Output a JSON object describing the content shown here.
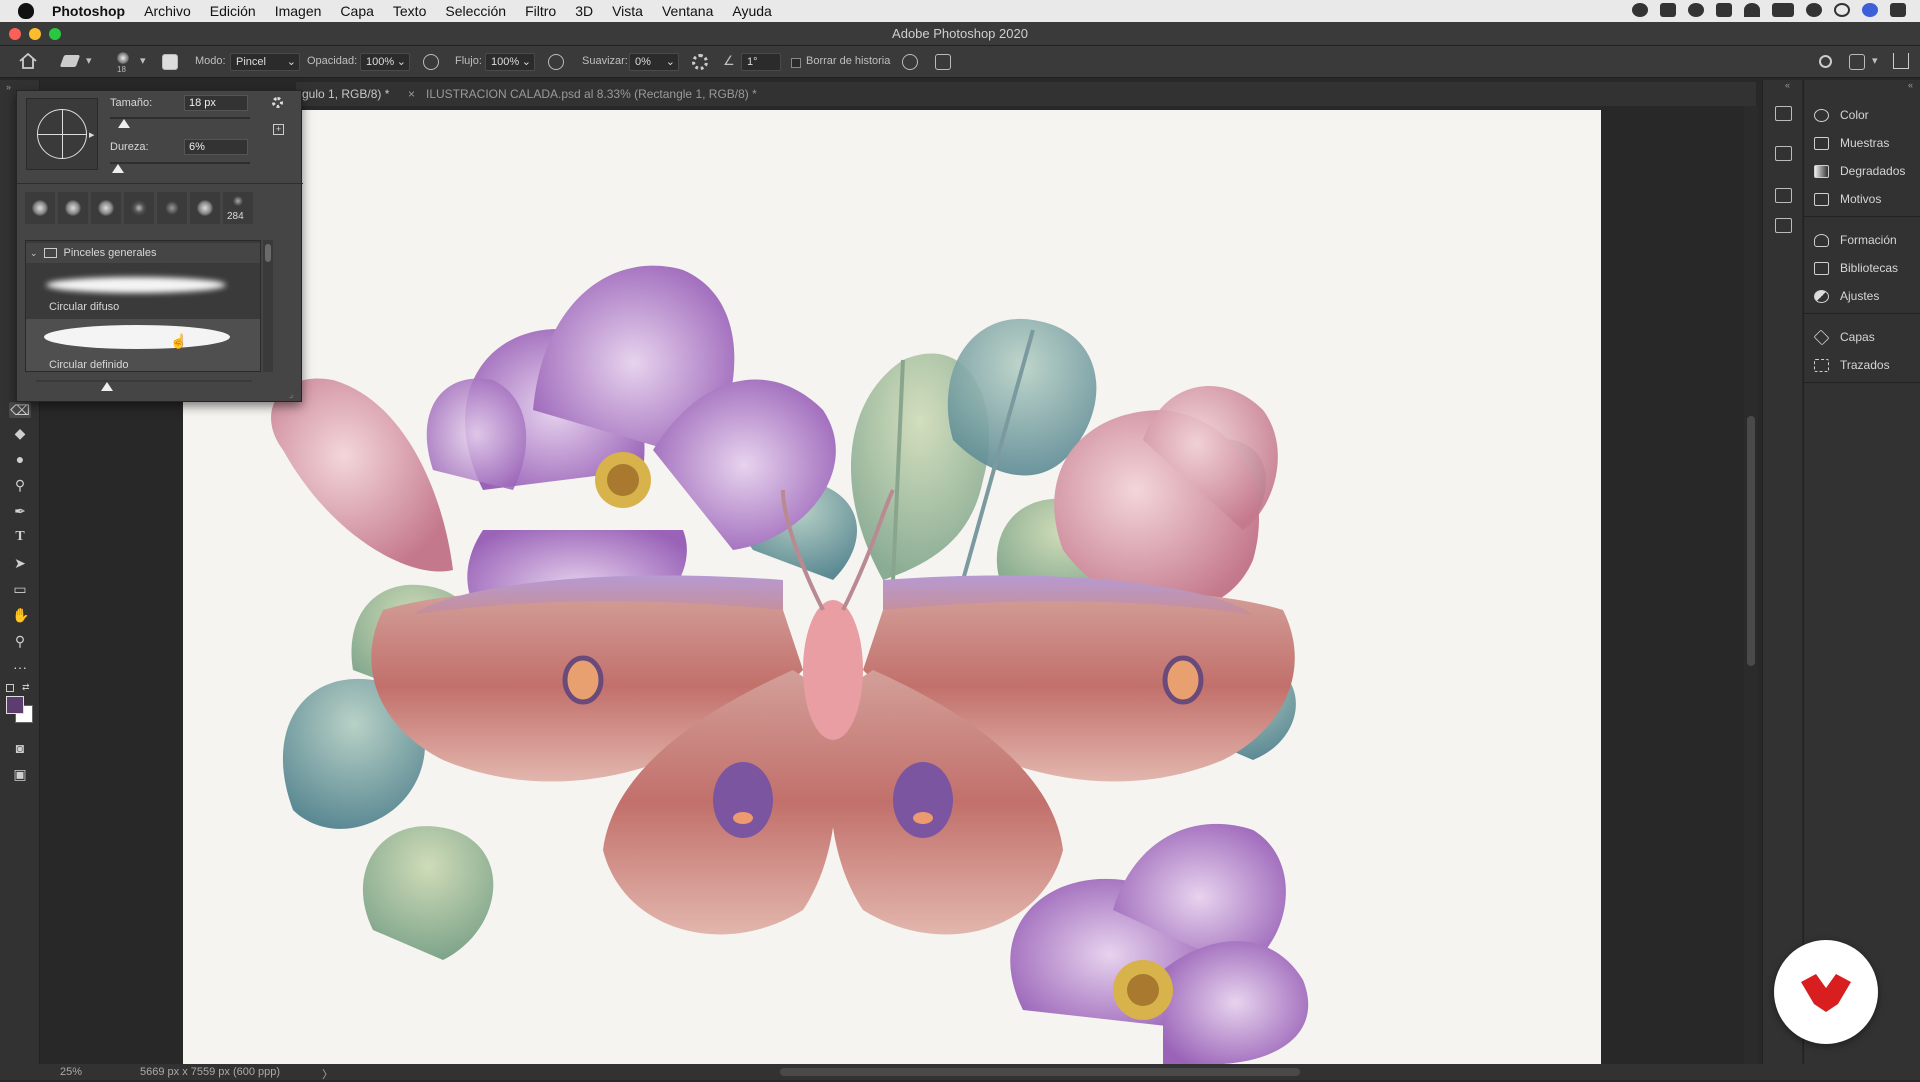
{
  "menubar": {
    "app": "Photoshop",
    "items": [
      "Archivo",
      "Edición",
      "Imagen",
      "Capa",
      "Texto",
      "Selección",
      "Filtro",
      "3D",
      "Vista",
      "Ventana",
      "Ayuda"
    ]
  },
  "window": {
    "title": "Adobe Photoshop 2020"
  },
  "options": {
    "brush_size_small": "18",
    "mode_label": "Modo:",
    "mode_value": "Pincel",
    "opacity_label": "Opacidad:",
    "opacity_value": "100%",
    "flow_label": "Flujo:",
    "flow_value": "100%",
    "smooth_label": "Suavizar:",
    "smooth_value": "0%",
    "angle_value": "1°",
    "history_label": "Borrar de historia"
  },
  "tabs": [
    {
      "label": "gulo 1, RGB/8) *"
    },
    {
      "close": "×",
      "label": "ILUSTRACION CALADA.psd al 8.33% (Rectangle 1, RGB/8) *"
    }
  ],
  "brush_panel": {
    "size_label": "Tamaño:",
    "size_value": "18 px",
    "size_level": 0.1,
    "hardness_label": "Dureza:",
    "hardness_value": "6%",
    "hardness_level": 0.06,
    "tip_count": "284",
    "folder_label": "Pinceles generales",
    "brushes": [
      {
        "name": "Circular difuso"
      },
      {
        "name": "Circular definido"
      }
    ],
    "preview_level": 0.33
  },
  "right_panel": {
    "group1": [
      "Color",
      "Muestras",
      "Degradados",
      "Motivos"
    ],
    "group2": [
      "Formación",
      "Bibliotecas",
      "Ajustes"
    ],
    "group3": [
      "Capas",
      "Trazados"
    ]
  },
  "status": {
    "zoom": "25%",
    "doc_info": "5669 px x 7559 px (600 ppp)",
    "arrow": "〉"
  },
  "colors": {
    "foreground": "#5b3d6e",
    "background": "#ffffff",
    "brand": "#d81e1e"
  }
}
